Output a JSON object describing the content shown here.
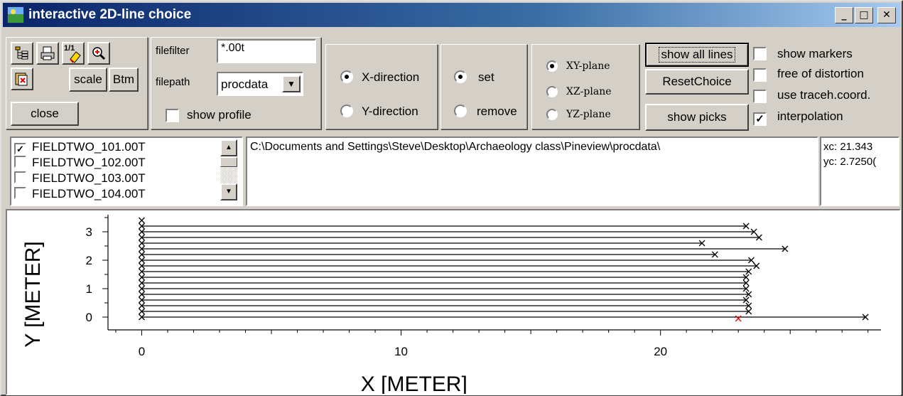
{
  "window": {
    "title": "interactive 2D-line choice",
    "minimize": "_",
    "maximize": "□",
    "close": "✕"
  },
  "toolbar": {
    "scale_label": "scale",
    "btm_label": "Btm",
    "close_label": "close",
    "ratio_icon_text": "1/1"
  },
  "files": {
    "filefilter_label": "filefilter",
    "filefilter_value": "*.00t",
    "filepath_label": "filepath",
    "filepath_value": "procdata",
    "show_profile_label": "show profile",
    "show_profile_checked": false
  },
  "direction": {
    "options": [
      "X-direction",
      "Y-direction"
    ],
    "selected": "X-direction"
  },
  "mode": {
    "options": [
      "set",
      "remove"
    ],
    "selected": "set"
  },
  "plane": {
    "options": [
      "XY-plane",
      "XZ-plane",
      "YZ-plane"
    ],
    "selected": "XY-plane"
  },
  "actions": {
    "show_all_lines": "show all lines",
    "reset_choice": "ResetChoice",
    "show_picks": "show picks"
  },
  "options": [
    {
      "label": "show markers",
      "checked": false
    },
    {
      "label": "free of distortion",
      "checked": false
    },
    {
      "label": "use traceh.coord.",
      "checked": false
    },
    {
      "label": "interpolation",
      "checked": true
    }
  ],
  "file_list": [
    {
      "name": "FIELDTWO_101.00T",
      "checked": true
    },
    {
      "name": "FIELDTWO_102.00T",
      "checked": false
    },
    {
      "name": "FIELDTWO_103.00T",
      "checked": false
    },
    {
      "name": "FIELDTWO_104.00T",
      "checked": false
    }
  ],
  "path_text": "C:\\Documents and Settings\\Steve\\Desktop\\Archaeology class\\Pineview\\procdata\\",
  "coords": {
    "xc": "xc: 21.343",
    "yc": "yc: 2.7250("
  },
  "chart_data": {
    "type": "line",
    "xlabel": "X [METER]",
    "ylabel": "Y [METER]",
    "xlim": [
      -1.3,
      28.5
    ],
    "ylim": [
      -0.45,
      3.6
    ],
    "xticks": [
      "0",
      "10",
      "20"
    ],
    "yticks": [
      "0",
      "1",
      "2",
      "3"
    ],
    "line_color": "#000000",
    "marker": "x",
    "highlight_color": "#e00000",
    "highlight_point": [
      23.0,
      -0.05
    ],
    "lines": [
      {
        "y": 0.0,
        "x_start": 0.0,
        "x_end": 27.9
      },
      {
        "y": 0.2,
        "x_start": 0.0,
        "x_end": 23.4
      },
      {
        "y": 0.4,
        "x_start": 0.0,
        "x_end": 23.4
      },
      {
        "y": 0.6,
        "x_start": 0.0,
        "x_end": 23.3
      },
      {
        "y": 0.8,
        "x_start": 0.0,
        "x_end": 23.4
      },
      {
        "y": 1.0,
        "x_start": 0.0,
        "x_end": 23.3
      },
      {
        "y": 1.2,
        "x_start": 0.0,
        "x_end": 23.3
      },
      {
        "y": 1.4,
        "x_start": 0.0,
        "x_end": 23.3
      },
      {
        "y": 1.6,
        "x_start": 0.0,
        "x_end": 23.4
      },
      {
        "y": 1.8,
        "x_start": 0.0,
        "x_end": 23.7
      },
      {
        "y": 2.0,
        "x_start": 0.0,
        "x_end": 23.5
      },
      {
        "y": 2.2,
        "x_start": 0.0,
        "x_end": 22.1
      },
      {
        "y": 2.4,
        "x_start": 0.0,
        "x_end": 24.8
      },
      {
        "y": 2.6,
        "x_start": 0.0,
        "x_end": 21.6
      },
      {
        "y": 2.8,
        "x_start": 0.0,
        "x_end": 23.8
      },
      {
        "y": 3.0,
        "x_start": 0.0,
        "x_end": 23.6
      },
      {
        "y": 3.2,
        "x_start": 0.0,
        "x_end": 23.3
      },
      {
        "y": 3.4,
        "x_start": 0.0,
        "x_end": 0.0
      }
    ]
  }
}
